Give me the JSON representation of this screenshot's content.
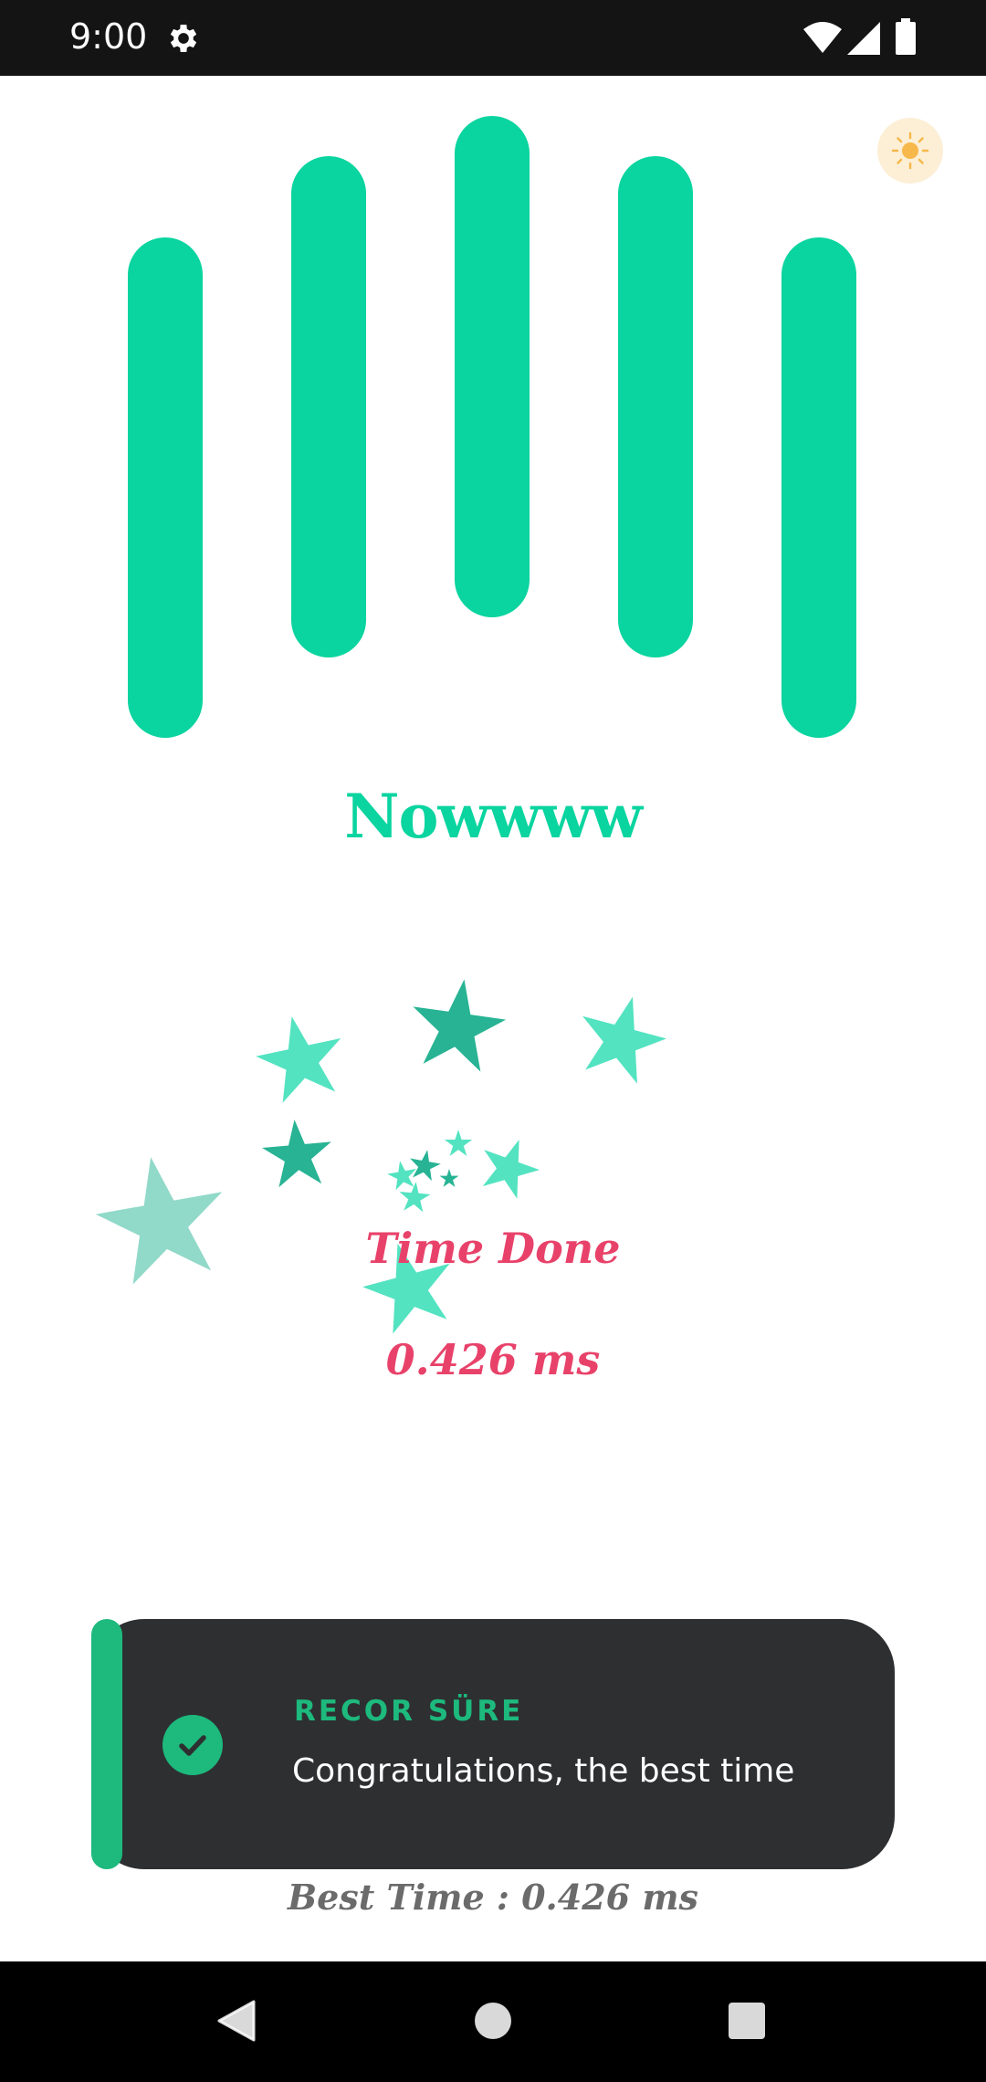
{
  "status_bar": {
    "time": "9:00",
    "icons": [
      "settings-icon",
      "wifi-icon",
      "cellular-signal-icon",
      "battery-icon"
    ]
  },
  "theme_toggle": {
    "icon": "sun-icon"
  },
  "colors": {
    "accent": "#0ad49f",
    "alert": "#e8426a",
    "muted_text": "#6b6b6b",
    "toast_bg": "#2e2f31",
    "toast_accent": "#1db97d",
    "star_light": "#53e3c1",
    "star_dark": "#27b394",
    "star_pale": "#91d9c9",
    "sun": "#f6b84a"
  },
  "headline": "Nowwww",
  "result": {
    "label": "Time Done",
    "value": "0.426 ms"
  },
  "toast": {
    "title": "RECOR SÜRE",
    "message": "Congratulations, the best time",
    "icon": "check-circle-icon"
  },
  "best_time": "Best Time : 0.426 ms",
  "nav_bar": {
    "buttons": [
      "back-icon",
      "home-icon",
      "recents-icon"
    ]
  }
}
